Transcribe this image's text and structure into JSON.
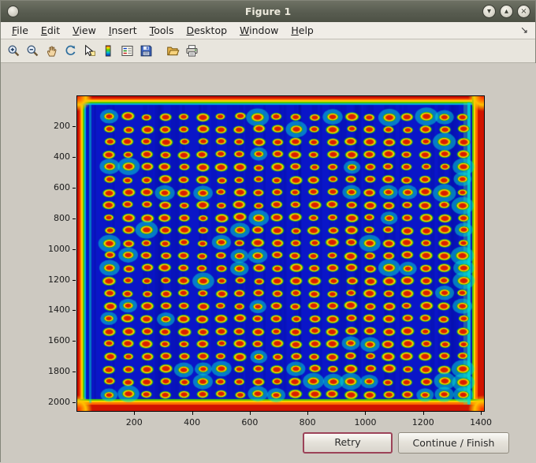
{
  "window": {
    "title": "Figure 1",
    "controls": [
      {
        "name": "minimize-button",
        "glyph": "▾"
      },
      {
        "name": "maximize-button",
        "glyph": "▴"
      },
      {
        "name": "close-button",
        "glyph": "×"
      }
    ]
  },
  "menubar": {
    "items": [
      {
        "label": "File"
      },
      {
        "label": "Edit"
      },
      {
        "label": "View"
      },
      {
        "label": "Insert"
      },
      {
        "label": "Tools"
      },
      {
        "label": "Desktop"
      },
      {
        "label": "Window"
      },
      {
        "label": "Help"
      }
    ],
    "dock_arrow": "↘"
  },
  "toolbar": {
    "items": [
      {
        "name": "zoom-in-icon"
      },
      {
        "name": "zoom-out-icon"
      },
      {
        "name": "pan-hand-icon"
      },
      {
        "name": "rotate-3d-icon"
      },
      {
        "name": "data-cursor-icon"
      },
      {
        "name": "colorbar-icon"
      },
      {
        "name": "legend-icon"
      },
      {
        "name": "save-icon"
      },
      {
        "name": "open-folder-icon",
        "group_break": true
      },
      {
        "name": "print-icon"
      }
    ]
  },
  "plot": {
    "x_ticks": [
      200,
      400,
      600,
      800,
      1000,
      1200,
      1400
    ],
    "y_ticks": [
      200,
      400,
      600,
      800,
      1000,
      1200,
      1400,
      1600,
      1800,
      2000
    ],
    "x_range": [
      0,
      1408
    ],
    "y_range": [
      0,
      2050
    ],
    "grid": {
      "cols": 20,
      "rows": 23
    },
    "description": "Jet-colormap scan of a microplate: grid of red wells with yellow-green rims on a deep blue background, hot red/orange borders on all edges"
  },
  "buttons": {
    "retry": "Retry",
    "continue": "Continue / Finish"
  }
}
